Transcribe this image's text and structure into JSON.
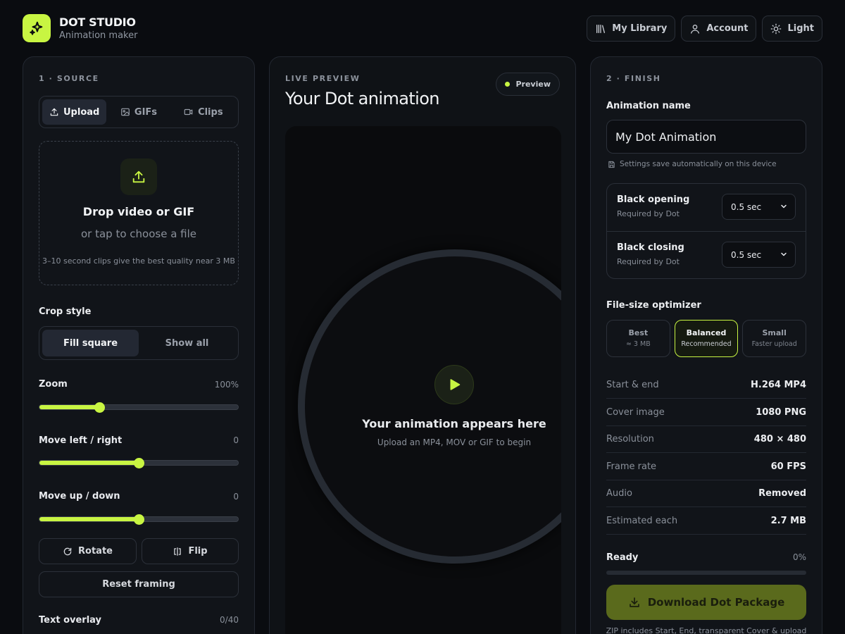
{
  "brand": {
    "title": "DOT STUDIO",
    "subtitle": "Animation maker"
  },
  "top_actions": {
    "library": "My Library",
    "account": "Account",
    "theme": "Light"
  },
  "source": {
    "eyebrow": "1 · SOURCE",
    "tabs": [
      {
        "label": "Upload",
        "active": true
      },
      {
        "label": "GIFs"
      },
      {
        "label": "Clips"
      }
    ],
    "drop_title": "Drop video or GIF",
    "drop_sub": "or tap to choose a file",
    "drop_hint": "3–10 second clips give the best quality near 3 MB",
    "crop_label": "Crop style",
    "crop_options": [
      {
        "label": "Fill square",
        "active": true
      },
      {
        "label": "Show all"
      }
    ],
    "zoom": {
      "label": "Zoom",
      "value_text": "100%",
      "fraction": 0.3
    },
    "move_x": {
      "label": "Move left / right",
      "value_text": "0",
      "fraction": 0.5
    },
    "move_y": {
      "label": "Move up / down",
      "value_text": "0",
      "fraction": 0.5
    },
    "rotate": "Rotate",
    "flip": "Flip",
    "reset": "Reset framing",
    "text_overlay": {
      "label": "Text overlay",
      "count": "0/40"
    }
  },
  "preview": {
    "eyebrow": "LIVE PREVIEW",
    "title": "Your Dot animation",
    "pill": "Preview",
    "stage_title": "Your animation appears here",
    "stage_sub": "Upload an MP4, MOV or GIF to begin"
  },
  "finish": {
    "eyebrow": "2 · FINISH",
    "name_label": "Animation name",
    "name_value": "My Dot Animation",
    "save_note": "Settings save automatically on this device",
    "opening": {
      "title": "Black opening",
      "sub": "Required by Dot",
      "value": "0.5 sec"
    },
    "closing": {
      "title": "Black closing",
      "sub": "Required by Dot",
      "value": "0.5 sec"
    },
    "optimizer_label": "File-size optimizer",
    "optimizer": [
      {
        "label": "Best",
        "sub": "≈ 3 MB"
      },
      {
        "label": "Balanced",
        "sub": "Recommended",
        "active": true
      },
      {
        "label": "Small",
        "sub": "Faster upload"
      }
    ],
    "specs": [
      {
        "k": "Start & end",
        "v": "H.264 MP4"
      },
      {
        "k": "Cover image",
        "v": "1080 PNG"
      },
      {
        "k": "Resolution",
        "v": "480 × 480"
      },
      {
        "k": "Frame rate",
        "v": "60 FPS"
      },
      {
        "k": "Audio",
        "v": "Removed"
      },
      {
        "k": "Estimated each",
        "v": "2.7 MB"
      }
    ],
    "ready_label": "Ready",
    "ready_pct": "0%",
    "progress_fraction": 0,
    "download": "Download Dot Package",
    "zip_note": "ZIP includes Start, End, transparent Cover & upload"
  },
  "colors": {
    "accent": "#c8f542",
    "bg": "#0a0c10",
    "panel": "#111419"
  }
}
